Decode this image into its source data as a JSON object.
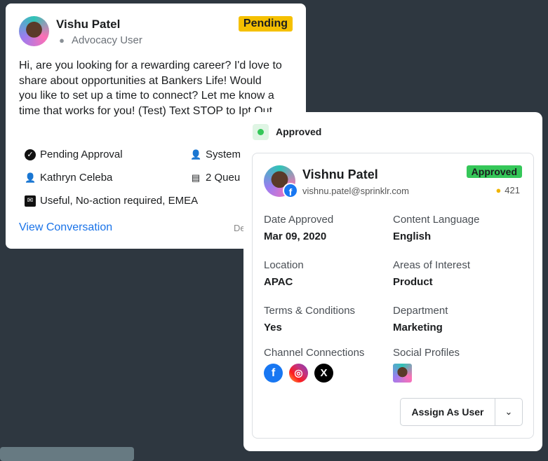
{
  "pending_card": {
    "name": "Vishu Patel",
    "role": "Advocacy User",
    "status": "Pending",
    "message": "Hi, are you looking for a rewarding career? I'd love to share about opportunities at Bankers Life! Would you like to set up a time to connect? Let me know a time that works for you! (Test) Text STOP to Ipt Out.",
    "meta": {
      "approval": "Pending Approval",
      "system": "System",
      "assignee": "Kathryn Celeba",
      "queues": "2 Queu",
      "tags": "Useful, No-action required, EMEA"
    },
    "view_link": "View Conversation",
    "date_partial": "De"
  },
  "approved_card": {
    "header": "Approved",
    "name": "Vishnu Patel",
    "email": "vishnu.patel@sprinklr.com",
    "status": "Approved",
    "points": "421",
    "fields": [
      {
        "label": "Date Approved",
        "value": "Mar 09, 2020"
      },
      {
        "label": "Content Language",
        "value": "English"
      },
      {
        "label": "Location",
        "value": "APAC"
      },
      {
        "label": "Areas of Interest",
        "value": "Product"
      },
      {
        "label": "Terms & Conditions",
        "value": "Yes"
      },
      {
        "label": "Department",
        "value": "Marketing"
      }
    ],
    "channel_label": "Channel Connections",
    "social_label": "Social Profiles",
    "channels": [
      "facebook-icon",
      "instagram-icon",
      "x-icon"
    ],
    "assign_button": "Assign As User"
  },
  "colors": {
    "pending": "#f5c000",
    "approved": "#35c759",
    "link": "#1a73e8",
    "background": "#2e3740"
  }
}
